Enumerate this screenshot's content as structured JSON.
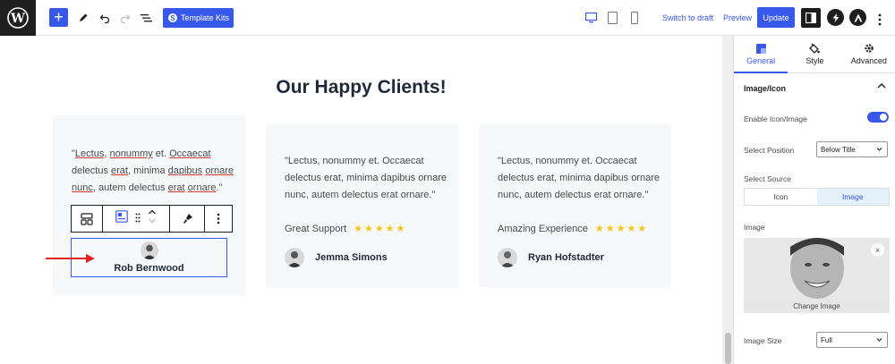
{
  "toolbar": {
    "template_kits_label": "Template Kits",
    "template_kits_badge": "S",
    "switch_to_draft": "Switch to draft",
    "preview": "Preview",
    "update": "Update"
  },
  "page": {
    "heading": "Our Happy Clients!"
  },
  "testimonials": [
    {
      "quote_parts": [
        "\"",
        "Lectus",
        ", ",
        "nonummy",
        " et. ",
        "Occaecat",
        " delectus ",
        "erat",
        ", minima ",
        "dapibus",
        " ",
        "ornare",
        " ",
        "nunc",
        ", autem delectus ",
        "erat",
        " ",
        "ornare",
        ".\""
      ],
      "name": "Rob Bernwood",
      "selected": true
    },
    {
      "quote": "\"Lectus, nonummy et. Occaecat delectus erat, minima dapibus ornare nunc, autem delectus erat ornare.\"",
      "label": "Great Support",
      "stars": "★★★★★",
      "name": "Jemma Simons"
    },
    {
      "quote": "\"Lectus, nonummy et. Occaecat delectus erat, minima dapibus ornare nunc, autem delectus erat ornare.\"",
      "label": "Amazing Experience",
      "stars": "★★★★★",
      "name": "Ryan Hofstadter"
    }
  ],
  "sidebar": {
    "tabs": [
      {
        "label": "General",
        "active": true
      },
      {
        "label": "Style",
        "active": false
      },
      {
        "label": "Advanced",
        "active": false
      }
    ],
    "panel_title": "Image/Icon",
    "enable_label": "Enable Icon/Image",
    "enable_value": true,
    "position_label": "Select Position",
    "position_value": "Below Title",
    "source_label": "Select Source",
    "source_options": [
      "Icon",
      "Image"
    ],
    "source_selected": "Image",
    "image_label": "Image",
    "change_image": "Change Image",
    "size_label": "Image Size",
    "size_value": "Full"
  },
  "colors": {
    "accent": "#3858e9",
    "star": "#f5c518",
    "arrow": "#e02424"
  }
}
